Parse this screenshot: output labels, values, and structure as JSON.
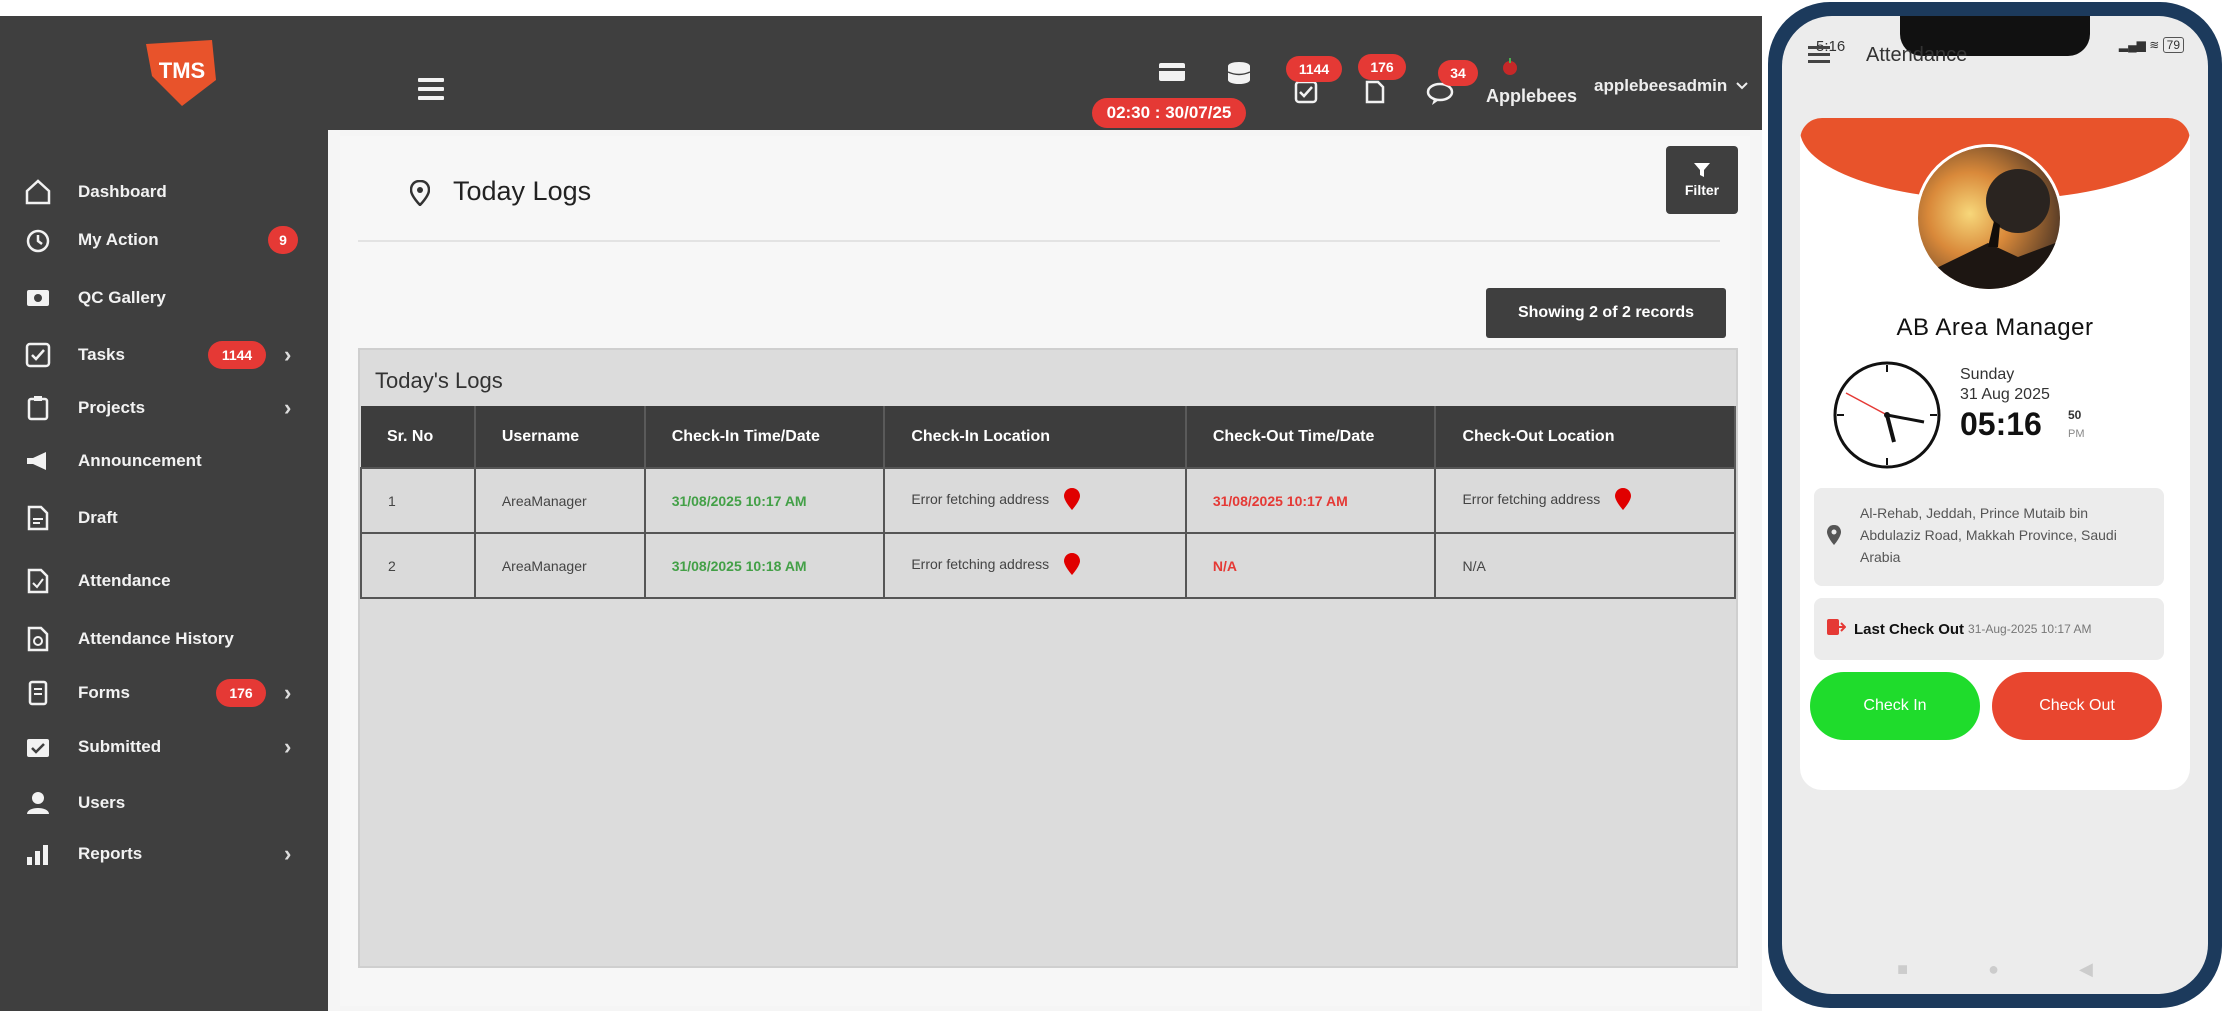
{
  "web": {
    "logo_text": "TMS",
    "clock_pill": "02:30 : 30/07/25",
    "badges": {
      "tasks_top": "1144",
      "forms_top": "176",
      "chat_top": "34"
    },
    "brand_text": "Applebees",
    "user_name": "applebeesadmin",
    "sidebar": [
      {
        "label": "Dashboard",
        "icon": "home-icon"
      },
      {
        "label": "My Action",
        "icon": "alarm-icon",
        "badge": "9"
      },
      {
        "label": "QC Gallery",
        "icon": "gallery-icon"
      },
      {
        "label": "Tasks",
        "icon": "check-square-icon",
        "badge": "1144",
        "chevron": true
      },
      {
        "label": "Projects",
        "icon": "clipboard-icon",
        "chevron": true
      },
      {
        "label": "Announcement",
        "icon": "megaphone-icon"
      },
      {
        "label": "Draft",
        "icon": "draft-icon"
      },
      {
        "label": "Attendance",
        "icon": "attendance-icon"
      },
      {
        "label": "Attendance History",
        "icon": "attendance-history-icon"
      },
      {
        "label": "Forms",
        "icon": "forms-icon",
        "badge": "176",
        "chevron": true
      },
      {
        "label": "Submitted",
        "icon": "submitted-icon",
        "chevron": true
      },
      {
        "label": "Users",
        "icon": "users-icon"
      },
      {
        "label": "Reports",
        "icon": "reports-icon",
        "chevron": true
      }
    ],
    "page_title": "Today Logs",
    "filter_label": "Filter",
    "records_label": "Showing 2 of 2 records",
    "panel_title": "Today's Logs",
    "table": {
      "columns": [
        "Sr. No",
        "Username",
        "Check-In Time/Date",
        "Check-In Location",
        "Check-Out Time/Date",
        "Check-Out Location"
      ],
      "rows": [
        [
          "1",
          "AreaManager",
          "31/08/2025 10:17 AM",
          "Error fetching address",
          "31/08/2025 10:17 AM",
          "Error fetching address"
        ],
        [
          "2",
          "AreaManager",
          "31/08/2025 10:18 AM",
          "Error fetching address",
          "N/A",
          "N/A"
        ]
      ]
    }
  },
  "mobile": {
    "status_time": "5:16",
    "status_battery": "79",
    "app_title": "Attendance",
    "name": "AB Area Manager",
    "day": "Sunday",
    "date": "31 Aug 2025",
    "time": "05:16",
    "seconds": "50",
    "ampm": "PM",
    "address": "Al-Rehab, Jeddah, Prince Mutaib bin Abdulaziz Road, Makkah Province, Saudi Arabia",
    "last_checkout_label": "Last Check Out",
    "last_checkout_value": "31-Aug-2025 10:17 AM",
    "checkin_label": "Check In",
    "checkout_label": "Check Out",
    "accent_orange": "#e8532b",
    "accent_green": "#1fdc2c",
    "accent_red": "#e8462f"
  }
}
